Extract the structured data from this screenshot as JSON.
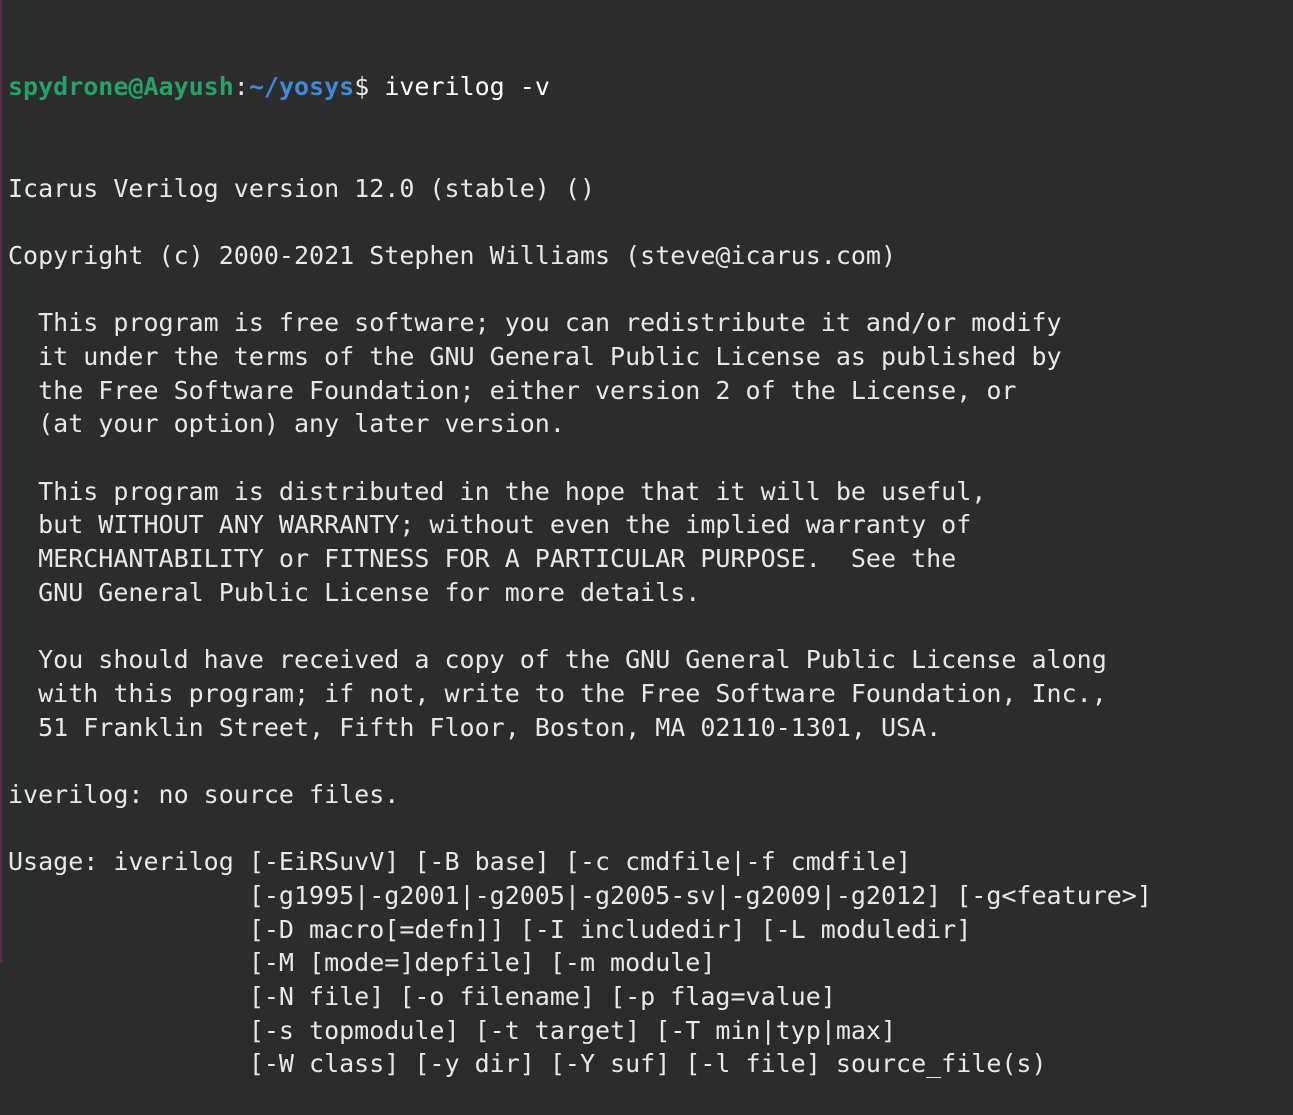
{
  "terminal": {
    "prompt": {
      "user_host": "spydrone@Aayush",
      "colon": ":",
      "path": "~/yosys",
      "dollar": "$ ",
      "command": "iverilog -v"
    },
    "lines": [
      "Icarus Verilog version 12.0 (stable) ()",
      "",
      "Copyright (c) 2000-2021 Stephen Williams (steve@icarus.com)",
      "",
      "  This program is free software; you can redistribute it and/or modify",
      "  it under the terms of the GNU General Public License as published by",
      "  the Free Software Foundation; either version 2 of the License, or",
      "  (at your option) any later version.",
      "",
      "  This program is distributed in the hope that it will be useful,",
      "  but WITHOUT ANY WARRANTY; without even the implied warranty of",
      "  MERCHANTABILITY or FITNESS FOR A PARTICULAR PURPOSE.  See the",
      "  GNU General Public License for more details.",
      "",
      "  You should have received a copy of the GNU General Public License along",
      "  with this program; if not, write to the Free Software Foundation, Inc.,",
      "  51 Franklin Street, Fifth Floor, Boston, MA 02110-1301, USA.",
      "",
      "iverilog: no source files.",
      "",
      "Usage: iverilog [-EiRSuvV] [-B base] [-c cmdfile|-f cmdfile]",
      "                [-g1995|-g2001|-g2005|-g2005-sv|-g2009|-g2012] [-g<feature>]",
      "                [-D macro[=defn]] [-I includedir] [-L moduledir]",
      "                [-M [mode=]depfile] [-m module]",
      "                [-N file] [-o filename] [-p flag=value]",
      "                [-s topmodule] [-t target] [-T min|typ|max]",
      "                [-W class] [-y dir] [-Y suf] [-l file] source_file(s)"
    ]
  },
  "colors": {
    "background": "#2c2c2c",
    "text": "#e8e8e8",
    "prompt_user": "#26a269",
    "prompt_path": "#3f8ad8"
  }
}
